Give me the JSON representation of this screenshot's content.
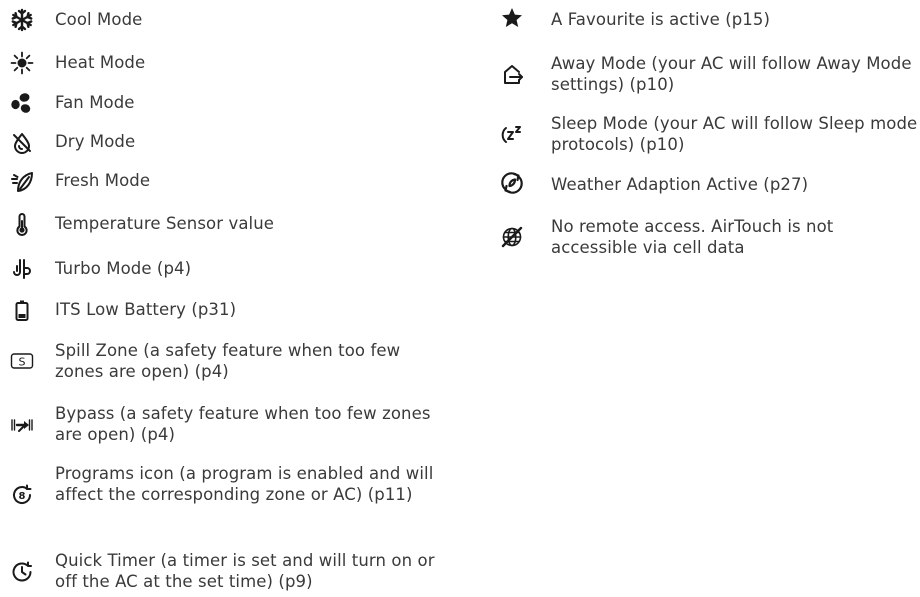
{
  "legend_left": [
    {
      "icon": "snowflake-icon",
      "label": "Cool Mode"
    },
    {
      "icon": "sun-icon",
      "label": "Heat Mode"
    },
    {
      "icon": "fan-icon",
      "label": "Fan Mode"
    },
    {
      "icon": "dry-drop-icon",
      "label": "Dry Mode"
    },
    {
      "icon": "leaf-icon",
      "label": "Fresh Mode"
    },
    {
      "icon": "thermometer-icon",
      "label": "Temperature Sensor value"
    },
    {
      "icon": "turbo-icon",
      "label": "Turbo Mode (p4)"
    },
    {
      "icon": "battery-low-icon",
      "label": "ITS Low Battery (p31)"
    },
    {
      "icon": "spill-zone-icon",
      "label": "Spill Zone (a safety feature when too few zones are open) (p4)"
    },
    {
      "icon": "bypass-icon",
      "label": "Bypass (a safety feature when too few zones are open) (p4)"
    },
    {
      "icon": "program-icon",
      "label": "Programs icon (a program is enabled and will affect the corresponding zone or AC) (p11)"
    },
    {
      "icon": "quick-timer-icon",
      "label": "Quick Timer (a timer is set and will turn on or off the AC at the set time) (p9)"
    }
  ],
  "legend_right": [
    {
      "icon": "star-icon",
      "label": "A Favourite is active (p15)"
    },
    {
      "icon": "away-mode-icon",
      "label": "Away Mode (your AC will follow Away Mode settings) (p10)"
    },
    {
      "icon": "sleep-mode-icon",
      "label": "Sleep Mode (your AC will follow Sleep mode protocols) (p10)"
    },
    {
      "icon": "weather-adaption-icon",
      "label": "Weather Adaption Active (p27)"
    },
    {
      "icon": "no-remote-access-icon",
      "label": "No remote access. AirTouch is not accessible via cell data"
    }
  ],
  "colors": {
    "text": "#3a3a3a",
    "icon": "#1a1a1a"
  }
}
